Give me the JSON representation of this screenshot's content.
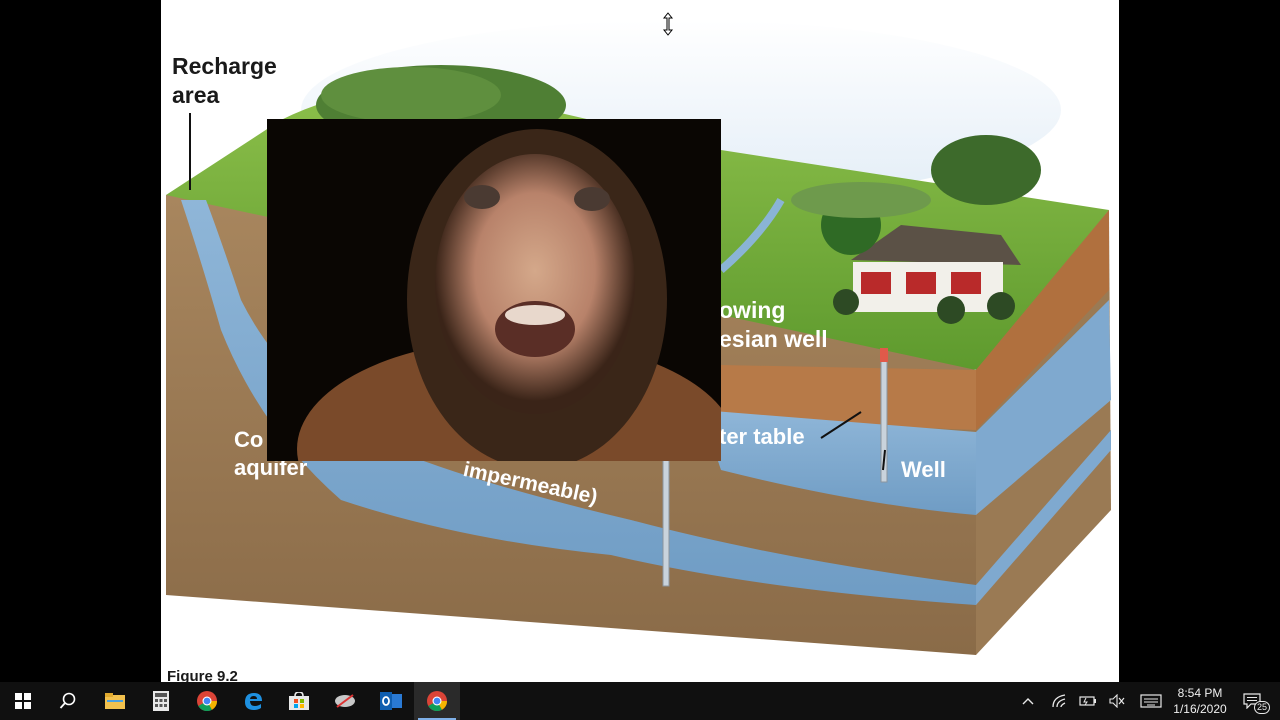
{
  "slide": {
    "labels": {
      "recharge_area": "Recharge\narea",
      "flowing_artesian_well": "owing\nesian well",
      "water_table": "ter table",
      "well": "Well",
      "confined_aquifer": "Co\naquifer",
      "impermeable": "impermeable)",
      "figure": "Figure 9.2"
    }
  },
  "webcam": {
    "description": "webcam-overlay"
  },
  "taskbar": {
    "pinned": [
      {
        "name": "start-button",
        "icon": "windows-logo-icon"
      },
      {
        "name": "search-button",
        "icon": "search-icon"
      },
      {
        "name": "file-explorer",
        "icon": "folder-icon"
      },
      {
        "name": "calculator",
        "icon": "calculator-icon"
      },
      {
        "name": "chrome",
        "icon": "chrome-icon"
      },
      {
        "name": "edge",
        "icon": "edge-icon"
      },
      {
        "name": "store",
        "icon": "store-icon"
      },
      {
        "name": "snipping-tool",
        "icon": "snip-icon"
      },
      {
        "name": "outlook",
        "icon": "outlook-icon"
      },
      {
        "name": "chrome-active",
        "icon": "chrome-icon"
      }
    ],
    "clock": {
      "time": "8:54 PM",
      "date": "1/16/2020"
    },
    "notification_count": "25",
    "colors": {
      "taskbar_bg": "#101010",
      "accent": "#7fb0e8"
    }
  }
}
